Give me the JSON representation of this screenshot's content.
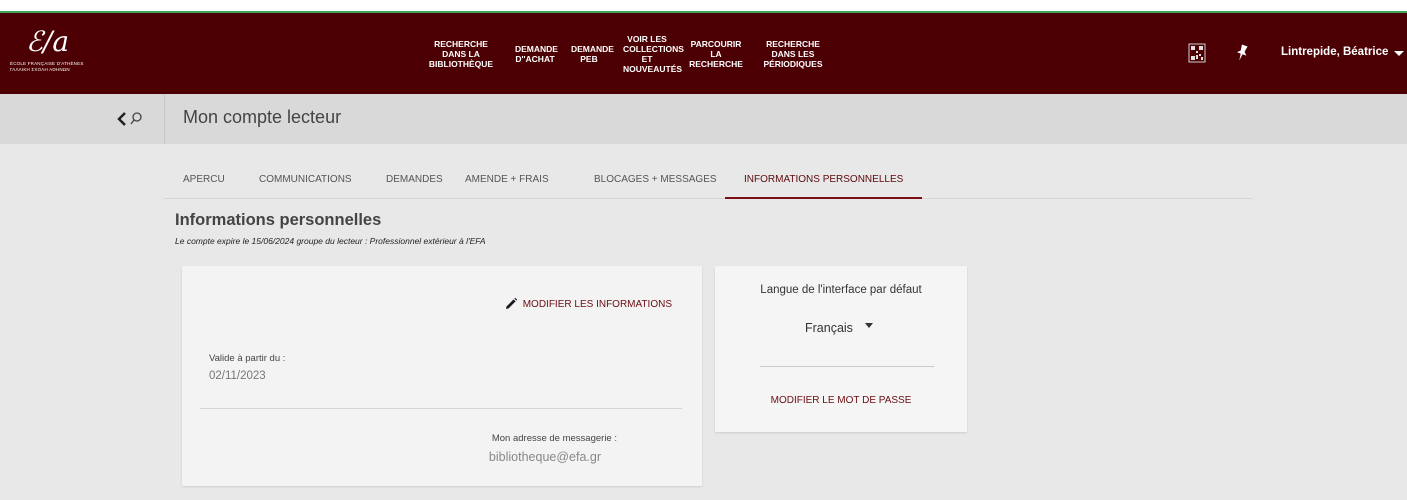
{
  "brand": {
    "logo_mark": "ℰ/a",
    "logo_line1": "ÉCOLE FRANÇAISE D'ATHÈNES",
    "logo_line2": "ΓΑΛΛΙΚΗ ΣΧΟΛΗ ΑΘΗΝΩΝ",
    "nav_color": "#4c0003",
    "accent_color": "#6a0d12"
  },
  "nav": {
    "items": [
      {
        "label": "RECHERCHE\nDANS LA\nBIBLIOTHÈQUE"
      },
      {
        "label": "DEMANDE\nD''ACHAT"
      },
      {
        "label": "DEMANDE\nPEB"
      },
      {
        "label": "VOIR LES\nCOLLECTIONS\nET\nNOUVEAUTÉS"
      },
      {
        "label": "PARCOURIR\nLA\nRECHERCHE"
      },
      {
        "label": "RECHERCHE\nDANS LES\nPÉRIODIQUES"
      }
    ],
    "qr_icon": "qr-code-icon",
    "pin_icon": "pin-icon",
    "user_name": "Lintrepide, Béatrice"
  },
  "titlebar": {
    "page_title": "Mon compte lecteur"
  },
  "tabs": [
    {
      "label": "APERCU"
    },
    {
      "label": "COMMUNICATIONS"
    },
    {
      "label": "DEMANDES"
    },
    {
      "label": "AMENDE + FRAIS"
    },
    {
      "label": "BLOCAGES + MESSAGES"
    },
    {
      "label": "INFORMATIONS PERSONNELLES",
      "active": true
    }
  ],
  "section": {
    "title": "Informations personnelles",
    "subtitle": "Le compte expire le 15/06/2024 groupe du lecteur : Professionnel extérieur à l'EFA"
  },
  "info_card": {
    "edit_label": "MODIFIER LES INFORMATIONS",
    "valid_from_label": "Valide à partir du :",
    "valid_from_value": "02/11/2023",
    "email_label": "Mon adresse de messagerie :",
    "email_value": "bibliotheque@efa.gr"
  },
  "lang_card": {
    "title": "Langue de l'interface par défaut",
    "selected": "Français",
    "password_label": "MODIFIER LE MOT DE PASSE"
  }
}
